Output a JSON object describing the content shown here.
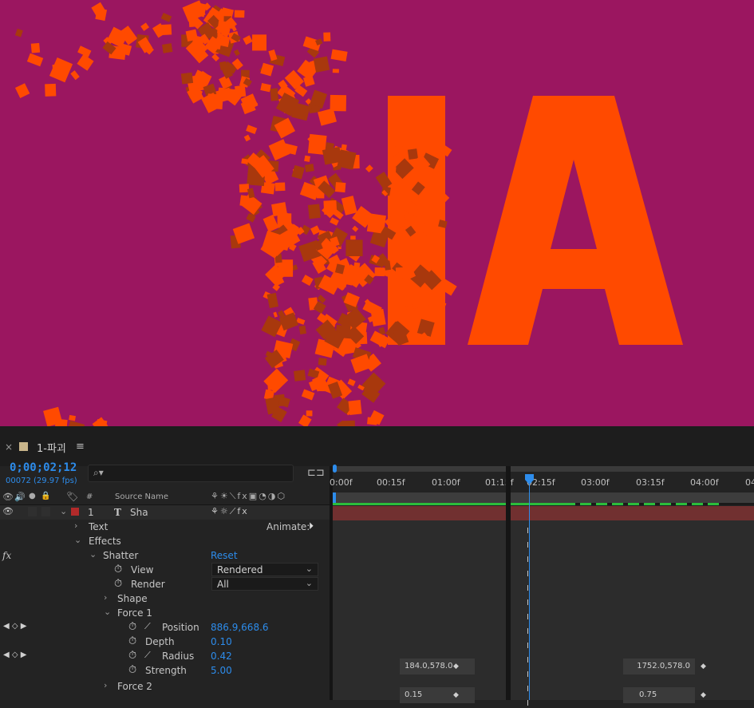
{
  "composition": {
    "tab_title": "1-파괴",
    "timecode": "0;00;02;12",
    "frame_info": "00072 (29.97 fps)"
  },
  "columns": {
    "number": "#",
    "source_name": "Source Name"
  },
  "layer": {
    "index": "1",
    "type_icon": "T",
    "name": "Sha",
    "animate_label": "Animate:"
  },
  "properties": {
    "text": "Text",
    "effects": "Effects",
    "fx_badge": "fx",
    "shatter": "Shatter",
    "reset": "Reset",
    "view": "View",
    "view_value": "Rendered",
    "render": "Render",
    "render_value": "All",
    "shape": "Shape",
    "force1": "Force 1",
    "position": "Position",
    "position_value": "886.9,668.6",
    "depth": "Depth",
    "depth_value": "0.10",
    "radius": "Radius",
    "radius_value": "0.42",
    "strength": "Strength",
    "strength_value": "5.00",
    "force2": "Force 2"
  },
  "ruler": {
    "ticks": [
      "0:00f",
      "00:15f",
      "01:00f",
      "01:15f",
      "02:15f",
      "03:00f",
      "03:15f",
      "04:00f",
      "04"
    ]
  },
  "keyframes": {
    "position_start": "184.0,578.0",
    "position_end": "1752.0,578.0",
    "radius_start": "0.15",
    "radius_end": "0.75"
  },
  "viewer": {
    "letters": "IA",
    "background_color": "#9b1660",
    "letter_color": "#ff4a00"
  }
}
